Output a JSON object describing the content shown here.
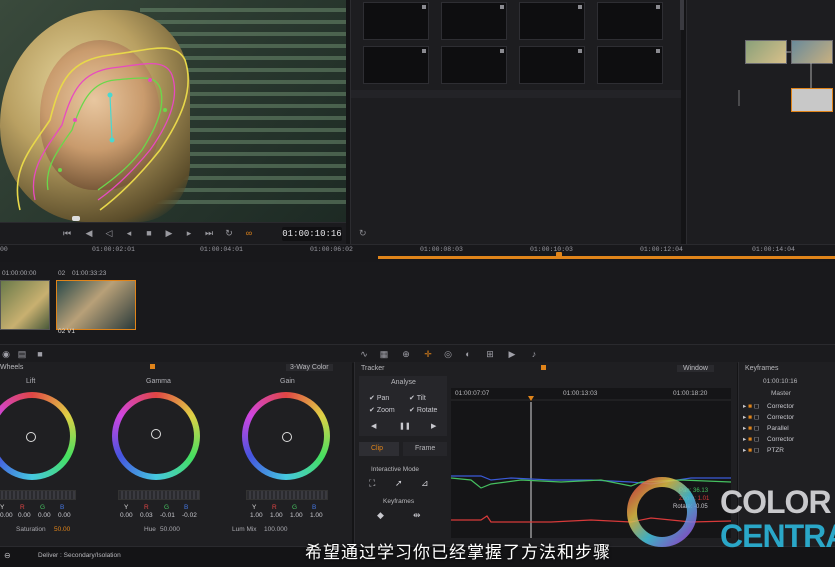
{
  "viewer": {
    "timecode": "01:00:10:16"
  },
  "ruler": {
    "ticks": [
      "00",
      "01:00:02:01",
      "01:00:04:01",
      "01:00:06:02",
      "01:00:08:03",
      "01:00:10:03",
      "01:00:12:04",
      "01:00:14:04"
    ]
  },
  "clips": {
    "clip1_tc": "01:00:00:00",
    "clip2_index": "02",
    "clip2_tc": "01:00:33:23",
    "clip2_label": "02  V1"
  },
  "wheels": {
    "mode_label": "3-Way Color",
    "section_label": "Wheels",
    "lift": {
      "label": "Lift",
      "values": [
        "0.00",
        "0.00",
        "0.00",
        "0.00"
      ]
    },
    "gamma": {
      "label": "Gamma",
      "values": [
        "0.00",
        "0.03",
        "-0.01",
        "-0.02"
      ]
    },
    "gain": {
      "label": "Gain",
      "values": [
        "1.00",
        "1.00",
        "1.00",
        "1.00"
      ]
    },
    "channels": [
      "Y",
      "R",
      "G",
      "B"
    ],
    "saturation_label": "Saturation",
    "saturation_value": "50.00",
    "hue_label": "Hue",
    "hue_value": "50.000",
    "lummix_label": "Lum Mix",
    "lummix_value": "100.000"
  },
  "tracker": {
    "title": "Tracker",
    "window_label": "Window",
    "analyse_label": "Analyse",
    "options": [
      "Pan",
      "Tilt",
      "Zoom",
      "Rotate"
    ],
    "clip_tab": "Clip",
    "frame_tab": "Frame",
    "interactive_mode": "Interactive Mode",
    "keyframes_label": "Keyframes",
    "graph_ticks": [
      "01:00:07:07",
      "01:00:13:03",
      "01:00:18:20"
    ],
    "legend": [
      "Pan: 36.13",
      "Zoom: 1.01",
      "Rotate: -0.05"
    ]
  },
  "keyframes": {
    "title": "Keyframes",
    "timecode": "01:00:10:16",
    "master_label": "Master",
    "rows": [
      "Corrector",
      "Corrector",
      "Parallel",
      "Corrector",
      "PTZR"
    ]
  },
  "status": {
    "project": "Deliver : Secondary/Isolation"
  },
  "subtitle": "希望通过学习你已经掌握了方法和步骤",
  "logo": {
    "line1": "COLOR",
    "line2": "CENTRA"
  },
  "colors": {
    "accent": "#e0841a",
    "logo_grey": "#c9c9cc",
    "logo_teal": "#2aa7c8"
  }
}
